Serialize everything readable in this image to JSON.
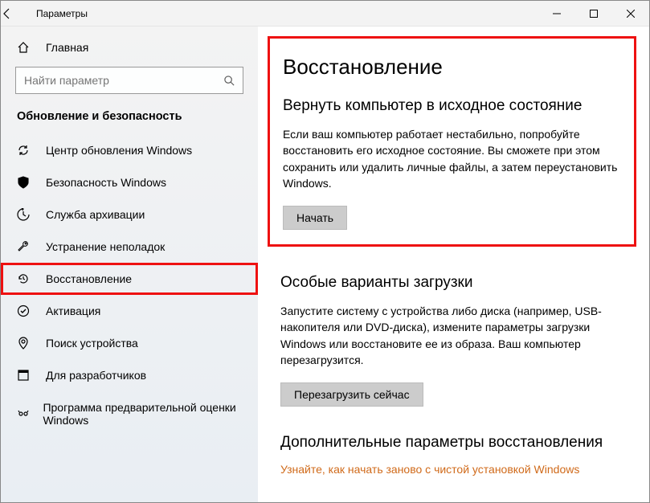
{
  "titlebar": {
    "title": "Параметры"
  },
  "sidebar": {
    "home": "Главная",
    "search_placeholder": "Найти параметр",
    "category": "Обновление и безопасность",
    "items": [
      {
        "label": "Центр обновления Windows",
        "icon": "sync"
      },
      {
        "label": "Безопасность Windows",
        "icon": "shield"
      },
      {
        "label": "Служба архивации",
        "icon": "backup"
      },
      {
        "label": "Устранение неполадок",
        "icon": "wrench"
      },
      {
        "label": "Восстановление",
        "icon": "history",
        "selected": true
      },
      {
        "label": "Активация",
        "icon": "check"
      },
      {
        "label": "Поиск устройства",
        "icon": "find"
      },
      {
        "label": "Для разработчиков",
        "icon": "dev"
      },
      {
        "label": "Программа предварительной оценки Windows",
        "icon": "insider"
      }
    ]
  },
  "content": {
    "heading": "Восстановление",
    "section1": {
      "title": "Вернуть компьютер в исходное состояние",
      "text": "Если ваш компьютер работает нестабильно, попробуйте восстановить его исходное состояние. Вы сможете при этом сохранить или удалить личные файлы, а затем переустановить Windows.",
      "button": "Начать"
    },
    "section2": {
      "title": "Особые варианты загрузки",
      "text": "Запустите систему с устройства либо диска (например, USB-накопителя или DVD-диска), измените параметры загрузки Windows или восстановите ее из образа. Ваш компьютер перезагрузится.",
      "button": "Перезагрузить сейчас"
    },
    "section3": {
      "title": "Дополнительные параметры восстановления",
      "link": "Узнайте, как начать заново с чистой установкой Windows"
    }
  }
}
